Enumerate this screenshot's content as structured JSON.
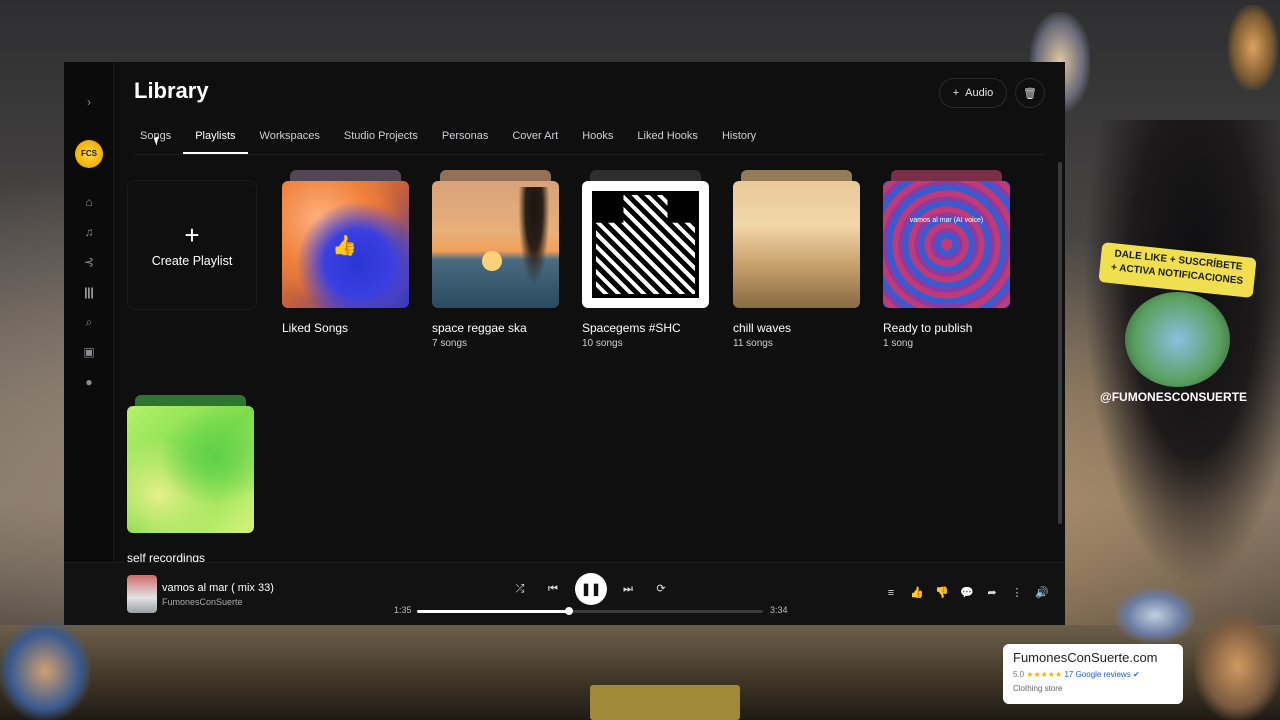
{
  "header": {
    "title": "Library",
    "audio_button": "Audio"
  },
  "tabs": [
    {
      "label": "Songs"
    },
    {
      "label": "Playlists"
    },
    {
      "label": "Workspaces"
    },
    {
      "label": "Studio Projects"
    },
    {
      "label": "Personas"
    },
    {
      "label": "Cover Art"
    },
    {
      "label": "Hooks"
    },
    {
      "label": "Liked Hooks"
    },
    {
      "label": "History"
    }
  ],
  "active_tab": "Playlists",
  "create_playlist": {
    "icon": "+",
    "label": "Create Playlist"
  },
  "playlists": [
    {
      "title": "Liked Songs",
      "count": "",
      "cover": "liked"
    },
    {
      "title": "space reggae ska",
      "count": "7 songs",
      "cover": "reggae"
    },
    {
      "title": "Spacegems #SHC",
      "count": "10 songs",
      "cover": "qr"
    },
    {
      "title": "chill waves",
      "count": "11 songs",
      "cover": "chill"
    },
    {
      "title": "Ready to publish",
      "count": "1 song",
      "cover": "ready",
      "caption": "vamos al mar (AI voice)"
    },
    {
      "title": "self recordings",
      "count": "",
      "cover": "green"
    }
  ],
  "player": {
    "title": "vamos al mar ( mix 33)",
    "artist": "FumonesConSuerte",
    "elapsed": "1:35",
    "duration": "3:34",
    "progress": 0.44
  },
  "rail": {
    "logo_text": "FCS"
  },
  "overlay": {
    "badge_line1": "DALE LIKE + SUSCRÍBETE",
    "badge_line2": "+ ACTIVA NOTIFICACIONES",
    "handle": "@FUMONESCONSUERTE",
    "review_name": "FumonesConSuerte.com",
    "review_rating": "5.0",
    "review_stars": "★★★★★",
    "review_count": "17 Google reviews",
    "review_category": "Clothing store"
  },
  "colors": {
    "accent": "#ffffff",
    "app_bg": "#0f0f10",
    "logo": "#f2b000"
  }
}
